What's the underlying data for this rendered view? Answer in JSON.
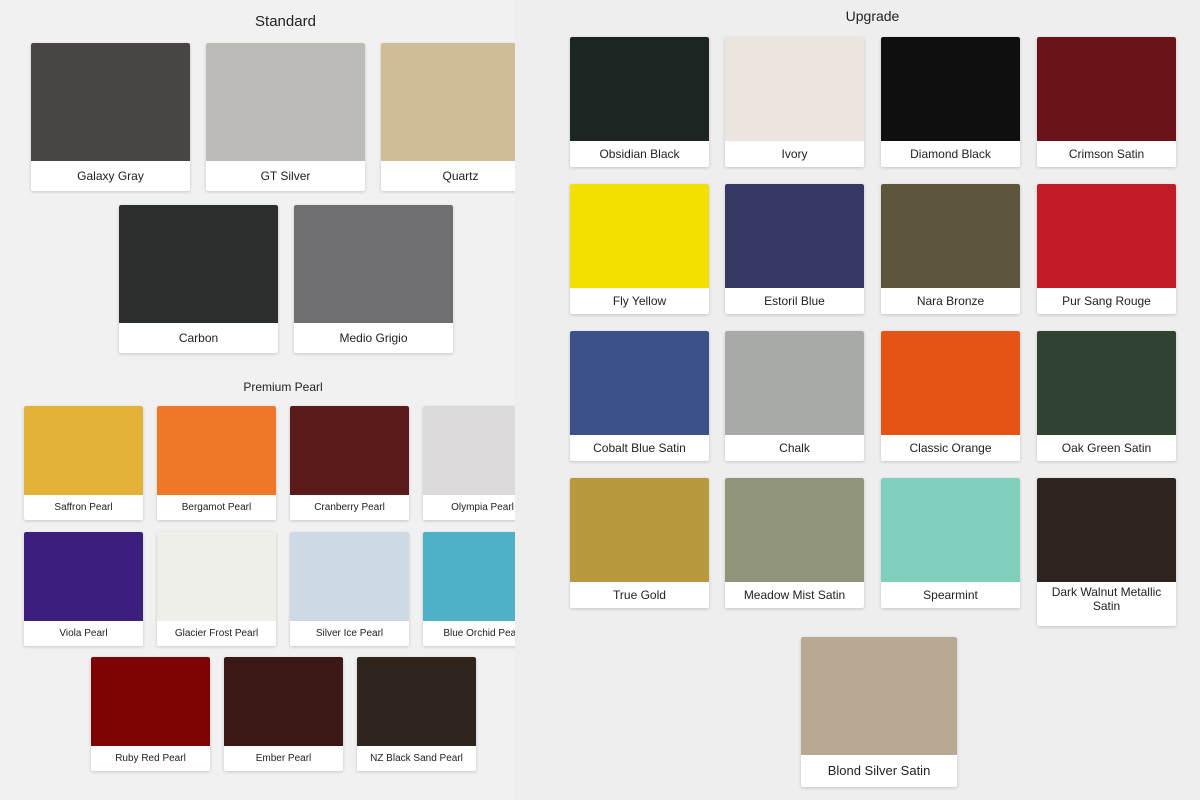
{
  "standard": {
    "title": "Standard",
    "colors": [
      {
        "name": "Galaxy Gray",
        "hex": "#4a4545"
      },
      {
        "name": "GT Silver",
        "hex": "#bcbbb8"
      },
      {
        "name": "Quartz",
        "hex": "#cfbd98"
      },
      {
        "name": "Carbon",
        "hex": "#2a2f2d"
      },
      {
        "name": "Medio Grigio",
        "hex": "#6f6f71"
      }
    ]
  },
  "premium_pearl": {
    "title": "Premium Pearl",
    "colors": [
      {
        "name": "Saffron Pearl",
        "hex": "#e3b238"
      },
      {
        "name": "Bergamot Pearl",
        "hex": "#ef7826"
      },
      {
        "name": "Cranberry Pearl",
        "hex": "#5a1a1a"
      },
      {
        "name": "Olympia Pearl",
        "hex": "#dcdadb"
      },
      {
        "name": "Viola Pearl",
        "hex": "#3c1f7c"
      },
      {
        "name": "Glacier Frost Pearl",
        "hex": "#efefea"
      },
      {
        "name": "Silver Ice Pearl",
        "hex": "#cdd9e4"
      },
      {
        "name": "Blue Orchid Pearl",
        "hex": "#4eb1c6"
      },
      {
        "name": "Ruby Red Pearl",
        "hex": "#7d0305"
      },
      {
        "name": "Ember Pearl",
        "hex": "#3b1715"
      },
      {
        "name": "NZ Black Sand Pearl",
        "hex": "#30251d"
      }
    ]
  },
  "upgrade": {
    "title": "Upgrade",
    "colors": [
      {
        "name": "Obsidian Black",
        "hex": "#1b2622"
      },
      {
        "name": "Ivory",
        "hex": "#ebe5dd"
      },
      {
        "name": "Diamond Black",
        "hex": "#0e0f0e"
      },
      {
        "name": "Crimson Satin",
        "hex": "#6a1419"
      },
      {
        "name": "Fly Yellow",
        "hex": "#f4e000"
      },
      {
        "name": "Estoril Blue",
        "hex": "#353863"
      },
      {
        "name": "Nara Bronze",
        "hex": "#5c563d"
      },
      {
        "name": "Pur Sang Rouge",
        "hex": "#c21b25"
      },
      {
        "name": "Cobalt Blue Satin",
        "hex": "#3c518a"
      },
      {
        "name": "Chalk",
        "hex": "#a8aaa7"
      },
      {
        "name": "Classic Orange",
        "hex": "#e55414"
      },
      {
        "name": "Oak Green Satin",
        "hex": "#2f4330"
      },
      {
        "name": "True Gold",
        "hex": "#b8993d"
      },
      {
        "name": "Meadow Mist Satin",
        "hex": "#909478"
      },
      {
        "name": "Spearmint",
        "hex": "#7ed0bd"
      },
      {
        "name": "Dark Walnut Metallic Satin",
        "hex": "#2e241f"
      },
      {
        "name": "Blond Silver Satin",
        "hex": "#b8a992"
      }
    ]
  }
}
